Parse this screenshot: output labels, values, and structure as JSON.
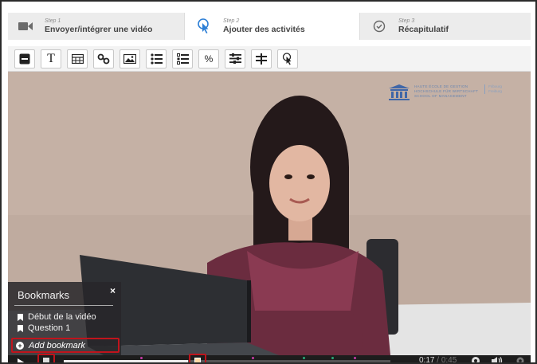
{
  "steps": [
    {
      "num": "Step 1",
      "title": "Envoyer/intégrer une vidéo",
      "icon": "video-camera-icon"
    },
    {
      "num": "Step 2",
      "title": "Ajouter des activités",
      "icon": "pointer-icon"
    },
    {
      "num": "Step 3",
      "title": "Récapitulatif",
      "icon": "check-circle-icon"
    }
  ],
  "toolbar": {
    "tools": [
      "minus-box-icon",
      "text-icon",
      "table-icon",
      "link-icon",
      "image-icon",
      "single-choice-list-icon",
      "multi-choice-list-icon",
      "percent-icon",
      "sliders-icon",
      "cross-icon",
      "pointer-icon"
    ],
    "text_tool_label": "T",
    "percent_label": "%"
  },
  "video": {
    "logo_lines": [
      "HAUTE ÉCOLE DE GESTION",
      "HOCHSCHULE FÜR WIRTSCHAFT",
      "SCHOOL OF MANAGEMENT"
    ],
    "logo_side": [
      "Fribourg",
      "Freiburg"
    ]
  },
  "bookmarks": {
    "title": "Bookmarks",
    "close": "×",
    "items": [
      "Début de la vidéo",
      "Question 1"
    ],
    "add_label": "Add bookmark"
  },
  "player": {
    "current_time": "0:17",
    "separator": " / ",
    "duration": "0:45",
    "progress": 0.38
  },
  "colors": {
    "highlight": "#c0141c",
    "accent_blue": "#2d7fd6",
    "cue_pink": "#c63aa6",
    "cue_green": "#2aa876"
  }
}
